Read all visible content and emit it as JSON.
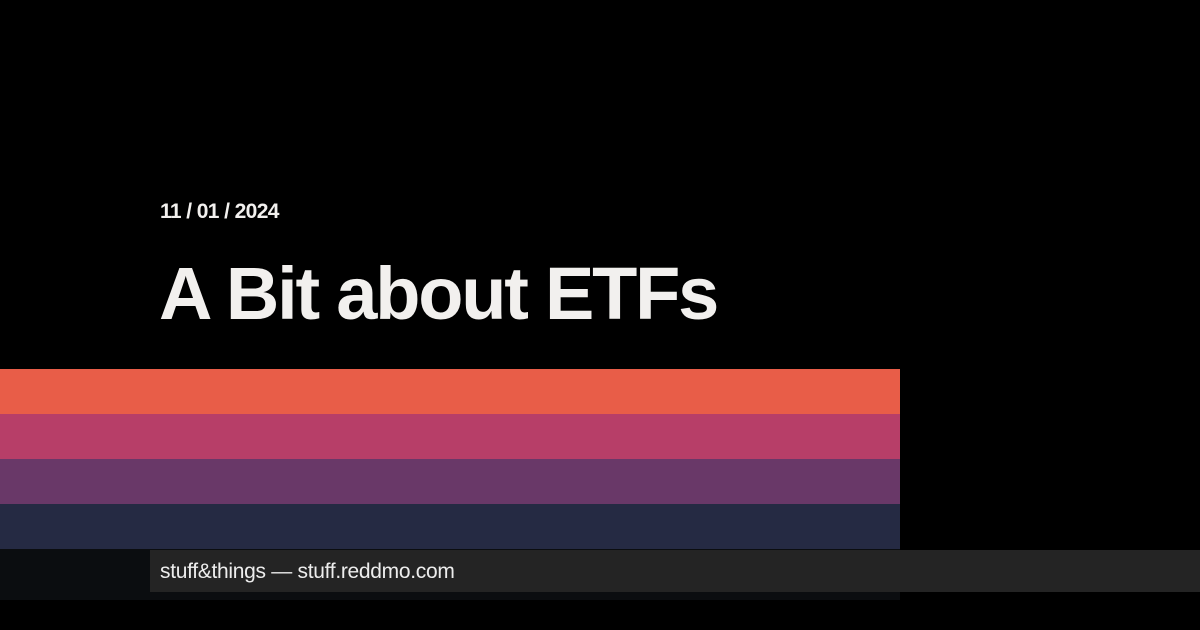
{
  "post": {
    "date": "11 / 01 / 2024",
    "title": "A Bit about ETFs"
  },
  "stripes": {
    "colors": [
      "#e85d48",
      "#b73e68",
      "#693868",
      "#252a43"
    ]
  },
  "footer": {
    "site_line": "stuff&things — stuff.reddmo.com"
  },
  "colors": {
    "background": "#000000",
    "text": "#f2f0ee",
    "footer_bar": "#242424"
  }
}
